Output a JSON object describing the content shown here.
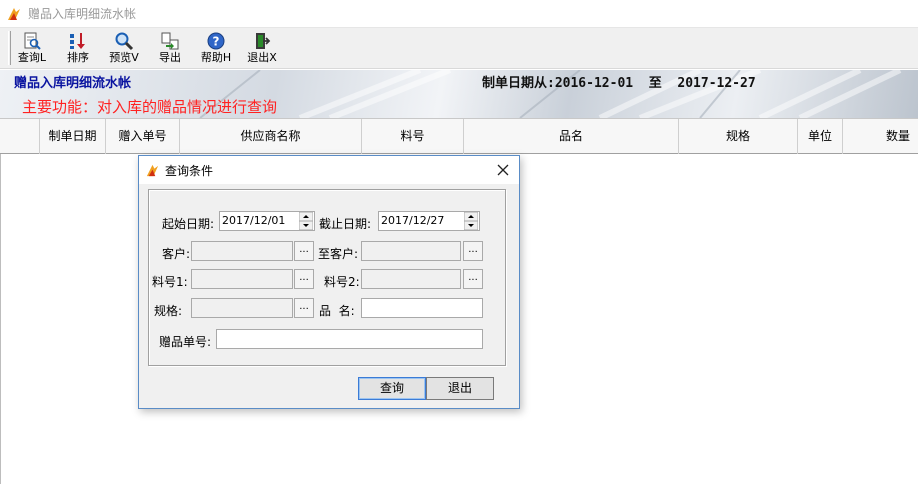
{
  "window": {
    "title": "赠品入库明细流水帐"
  },
  "toolbar": {
    "buttons": [
      {
        "label": "查询L",
        "icon": "query-icon"
      },
      {
        "label": "排序",
        "icon": "sort-icon"
      },
      {
        "label": "预览V",
        "icon": "preview-icon"
      },
      {
        "label": "导出",
        "icon": "export-icon"
      },
      {
        "label": "帮助H",
        "icon": "help-icon"
      },
      {
        "label": "退出X",
        "icon": "exit-icon"
      }
    ]
  },
  "banner": {
    "title": "赠品入库明细流水帐",
    "date_range": "制单日期从:2016-12-01  至  2017-12-27",
    "function_text": "主要功能：对入库的赠品情况进行查询"
  },
  "grid": {
    "columns": [
      "制单日期",
      "赠入单号",
      "供应商名称",
      "料号",
      "品名",
      "规格",
      "单位",
      "数量"
    ]
  },
  "dialog": {
    "title": "查询条件",
    "start_date_label": "起始日期:",
    "start_date_value": "2017/12/01",
    "end_date_label": "截止日期:",
    "end_date_value": "2017/12/27",
    "customer_label": "客户:",
    "to_customer_label": "至客户:",
    "item1_label": "料号1:",
    "item2_label": "料号2:",
    "spec_label": "规格:",
    "name_label": "品  名:",
    "gift_no_label": "赠品单号:",
    "ellipsis": "...",
    "query_button": "查询",
    "exit_button": "退出"
  },
  "colors": {
    "banner_title": "#0a14a0",
    "function_text": "#ff2222",
    "dialog_border": "#5a8cc6"
  }
}
